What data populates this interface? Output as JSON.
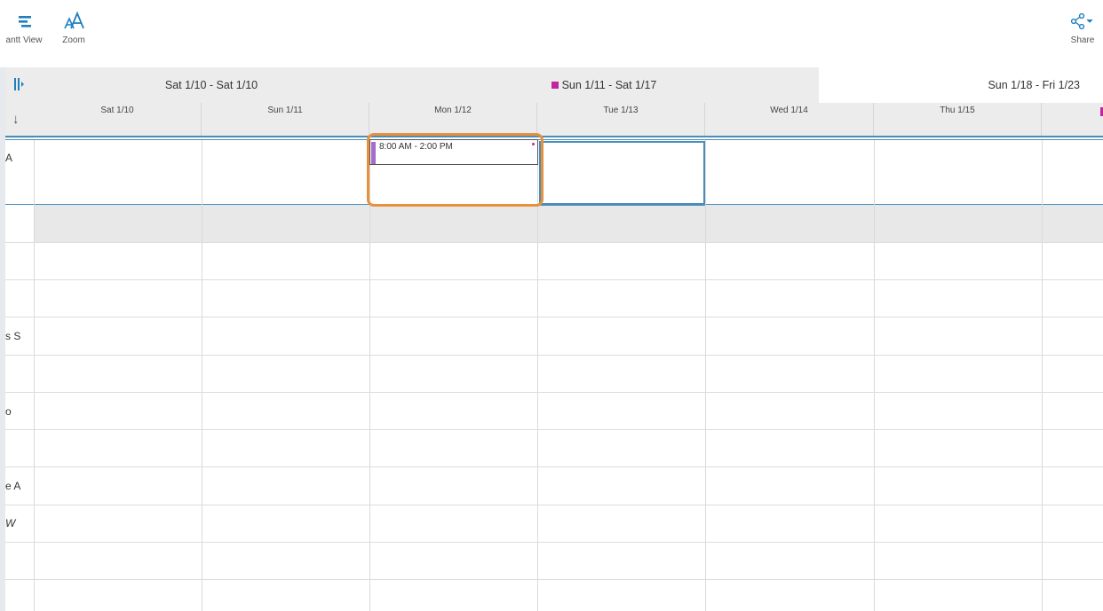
{
  "toolbar": {
    "gantt_label": "antt View",
    "zoom_label": "Zoom",
    "share_label": "Share"
  },
  "weeks": [
    {
      "label": "Sat 1/10 - Sat 1/10"
    },
    {
      "label": "Sun 1/11 - Sat 1/17"
    },
    {
      "label": "Sun 1/18 - Fri 1/23"
    }
  ],
  "days": [
    {
      "label": "Sat 1/10"
    },
    {
      "label": "Sun 1/11"
    },
    {
      "label": "Mon 1/12"
    },
    {
      "label": "Tue 1/13"
    },
    {
      "label": "Wed 1/14"
    },
    {
      "label": "Thu 1/15"
    }
  ],
  "rows": [
    {
      "label": "A"
    },
    {
      "label": "s S"
    },
    {
      "label": "o"
    },
    {
      "label": "e A"
    },
    {
      "label": "W"
    }
  ],
  "shift": {
    "time": "8:00 AM - 2:00 PM"
  },
  "colors": {
    "accent_blue": "#4a8db9",
    "highlight_orange": "#e8913c",
    "shift_purple": "#a66bcc",
    "marker_magenta": "#c2259e"
  },
  "icons": {
    "gantt": "gantt-view-icon",
    "zoom": "zoom-text-icon",
    "share": "share-icon",
    "collapse": "collapse-panel-icon",
    "sort": "arrow-down-icon"
  }
}
